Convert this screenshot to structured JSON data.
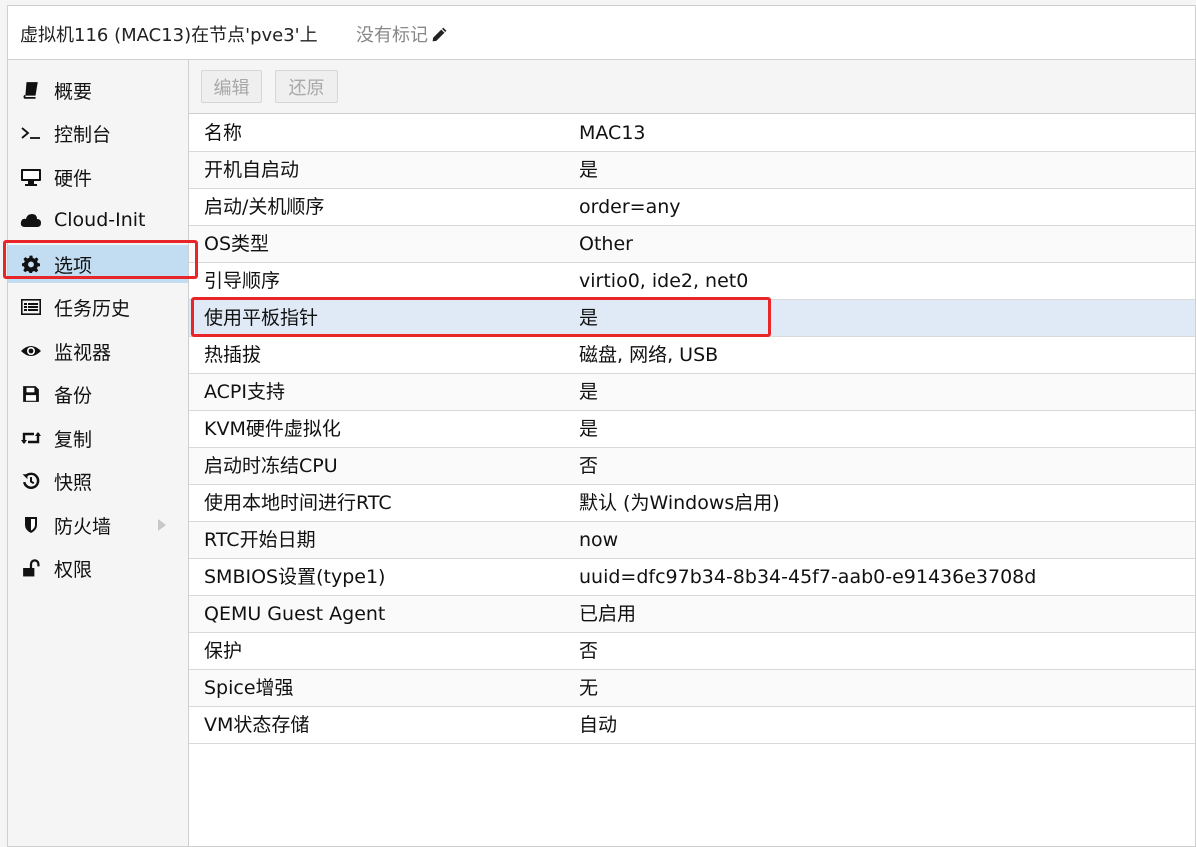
{
  "window": {
    "title": "虚拟机116 (MAC13)在节点'pve3'上",
    "tags_label": "没有标记",
    "tags_edit_icon": "pencil-icon"
  },
  "sidebar": {
    "items": [
      {
        "label": "概要",
        "icon": "book-icon"
      },
      {
        "label": "控制台",
        "icon": "terminal-icon"
      },
      {
        "label": "硬件",
        "icon": "desktop-icon"
      },
      {
        "label": "Cloud-Init",
        "icon": "cloud-icon"
      },
      {
        "label": "选项",
        "icon": "gear-icon",
        "selected": true
      },
      {
        "label": "任务历史",
        "icon": "list-icon"
      },
      {
        "label": "监视器",
        "icon": "eye-icon"
      },
      {
        "label": "备份",
        "icon": "floppy-icon"
      },
      {
        "label": "复制",
        "icon": "retweet-icon"
      },
      {
        "label": "快照",
        "icon": "history-icon"
      },
      {
        "label": "防火墙",
        "icon": "shield-icon",
        "expandable": true
      },
      {
        "label": "权限",
        "icon": "unlock-icon"
      }
    ]
  },
  "toolbar": {
    "edit_label": "编辑",
    "revert_label": "还原"
  },
  "options": [
    {
      "key": "名称",
      "value": "MAC13"
    },
    {
      "key": "开机自启动",
      "value": "是"
    },
    {
      "key": "启动/关机顺序",
      "value": "order=any"
    },
    {
      "key": "OS类型",
      "value": "Other"
    },
    {
      "key": "引导顺序",
      "value": "virtio0, ide2, net0"
    },
    {
      "key": "使用平板指针",
      "value": "是",
      "selected": true
    },
    {
      "key": "热插拔",
      "value": "磁盘, 网络, USB"
    },
    {
      "key": "ACPI支持",
      "value": "是"
    },
    {
      "key": "KVM硬件虚拟化",
      "value": "是"
    },
    {
      "key": "启动时冻结CPU",
      "value": "否"
    },
    {
      "key": "使用本地时间进行RTC",
      "value": "默认 (为Windows启用)"
    },
    {
      "key": "RTC开始日期",
      "value": "now"
    },
    {
      "key": "SMBIOS设置(type1)",
      "value": "uuid=dfc97b34-8b34-45f7-aab0-e91436e3708d"
    },
    {
      "key": "QEMU Guest Agent",
      "value": "已启用"
    },
    {
      "key": "保护",
      "value": "否"
    },
    {
      "key": "Spice增强",
      "value": "无"
    },
    {
      "key": "VM状态存储",
      "value": "自动"
    }
  ],
  "colors": {
    "highlight_box": "#e8262a",
    "selected_nav": "#c2ddf2",
    "selected_row": "#dfeaf6"
  }
}
